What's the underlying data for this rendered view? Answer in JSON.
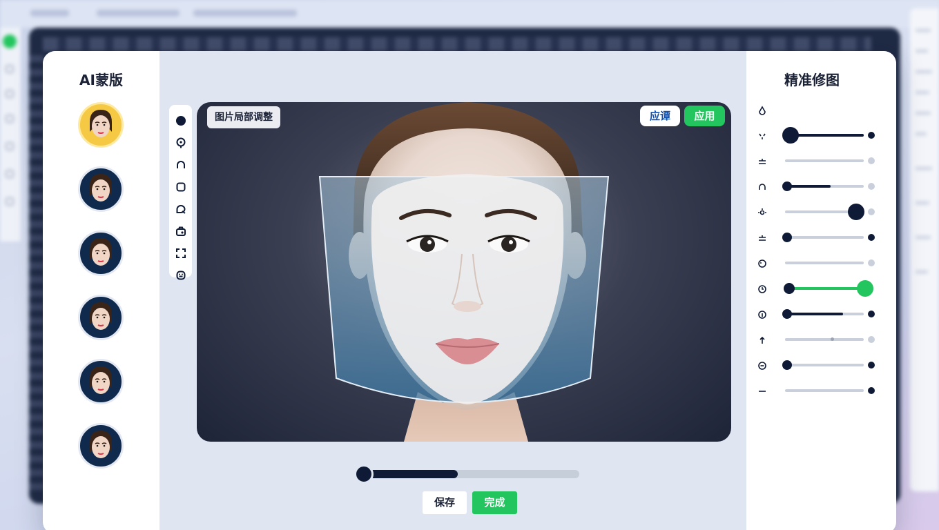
{
  "left_panel": {
    "title": "AI蒙版",
    "presets": [
      {
        "name": "preset-1",
        "selected": true
      },
      {
        "name": "preset-2",
        "selected": false
      },
      {
        "name": "preset-3",
        "selected": false
      },
      {
        "name": "preset-4",
        "selected": false
      },
      {
        "name": "preset-5",
        "selected": false
      },
      {
        "name": "preset-6",
        "selected": false
      }
    ]
  },
  "toolbar": {
    "tools": [
      "dot-icon",
      "balloon-icon",
      "headphone-icon",
      "square-icon",
      "chat-icon",
      "camera-icon",
      "crop-icon",
      "face-scan-icon"
    ]
  },
  "canvas": {
    "tag": "图片局部调整",
    "preview_button": "应谭",
    "apply_button": "应用"
  },
  "bottom": {
    "slider_value": 0.45,
    "save_label": "保存",
    "done_label": "完成"
  },
  "right_panel": {
    "title": "精准修图",
    "adjustments": [
      {
        "icon": "drop-icon",
        "value": null,
        "style": "header"
      },
      {
        "icon": "sparkle-icon",
        "value": 0.1,
        "style": "large-knob"
      },
      {
        "icon": "level-icon",
        "value": 0.0,
        "style": "empty"
      },
      {
        "icon": "headset-icon",
        "value": 0.05,
        "style": "partial"
      },
      {
        "icon": "brightness-icon",
        "value": 0.9,
        "style": "large-knob-right"
      },
      {
        "icon": "level-icon",
        "value": 0.05,
        "style": "small-knob"
      },
      {
        "icon": "palette-icon",
        "value": 0.0,
        "style": "empty"
      },
      {
        "icon": "clock-icon",
        "value": 0.95,
        "style": "green"
      },
      {
        "icon": "info-icon",
        "value": 0.05,
        "style": "partial-dark"
      },
      {
        "icon": "arrow-up-icon",
        "value": 0.6,
        "style": "dashed"
      },
      {
        "icon": "minus-circle-icon",
        "value": 0.05,
        "style": "small-knob"
      },
      {
        "icon": "dash-icon",
        "value": 0.0,
        "style": "empty"
      }
    ]
  },
  "colors": {
    "accent_green": "#22c55e",
    "navy": "#0e1a36",
    "link_blue": "#0f4fb0"
  }
}
